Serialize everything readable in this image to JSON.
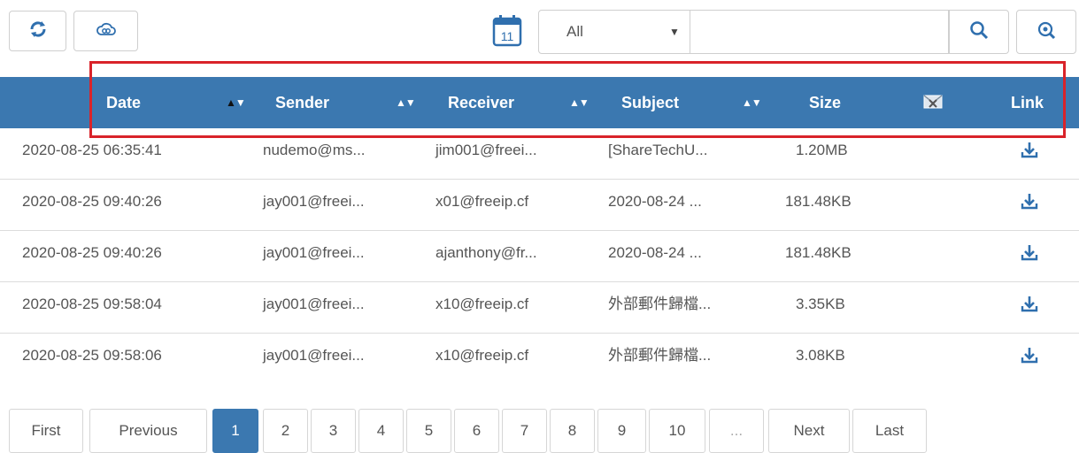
{
  "toolbar": {
    "refresh_icon": "refresh-icon",
    "cloud_icon": "cloud-link-icon",
    "calendar_icon": "calendar-icon",
    "calendar_day": "11",
    "filter_value": "All",
    "search_value": "",
    "search_icon": "search-icon",
    "advanced_search_icon": "advanced-search-icon"
  },
  "table": {
    "headers": {
      "date": "Date",
      "sender": "Sender",
      "receiver": "Receiver",
      "subject": "Subject",
      "size": "Size",
      "link": "Link"
    },
    "attachment_icon": "envelope-x-icon",
    "rows": [
      {
        "date": "2020-08-25 06:35:41",
        "sender": "nudemo@ms...",
        "receiver": "jim001@freei...",
        "subject": "[ShareTechU...",
        "size": "1.20MB"
      },
      {
        "date": "2020-08-25 09:40:26",
        "sender": "jay001@freei...",
        "receiver": "x01@freeip.cf",
        "subject": "2020-08-24 ...",
        "size": "181.48KB"
      },
      {
        "date": "2020-08-25 09:40:26",
        "sender": "jay001@freei...",
        "receiver": "ajanthony@fr...",
        "subject": "2020-08-24 ...",
        "size": "181.48KB"
      },
      {
        "date": "2020-08-25 09:58:04",
        "sender": "jay001@freei...",
        "receiver": "x10@freeip.cf",
        "subject": "外部郵件歸檔...",
        "size": "3.35KB"
      },
      {
        "date": "2020-08-25 09:58:06",
        "sender": "jay001@freei...",
        "receiver": "x10@freeip.cf",
        "subject": "外部郵件歸檔...",
        "size": "3.08KB"
      }
    ]
  },
  "pagination": {
    "first": "First",
    "previous": "Previous",
    "pages": [
      "1",
      "2",
      "3",
      "4",
      "5",
      "6",
      "7",
      "8",
      "9",
      "10"
    ],
    "ellipsis": "...",
    "next": "Next",
    "last": "Last",
    "current": "1"
  },
  "colors": {
    "header_bg": "#3b78b0",
    "highlight_border": "#d9232a",
    "icon_blue": "#2f6fae"
  }
}
